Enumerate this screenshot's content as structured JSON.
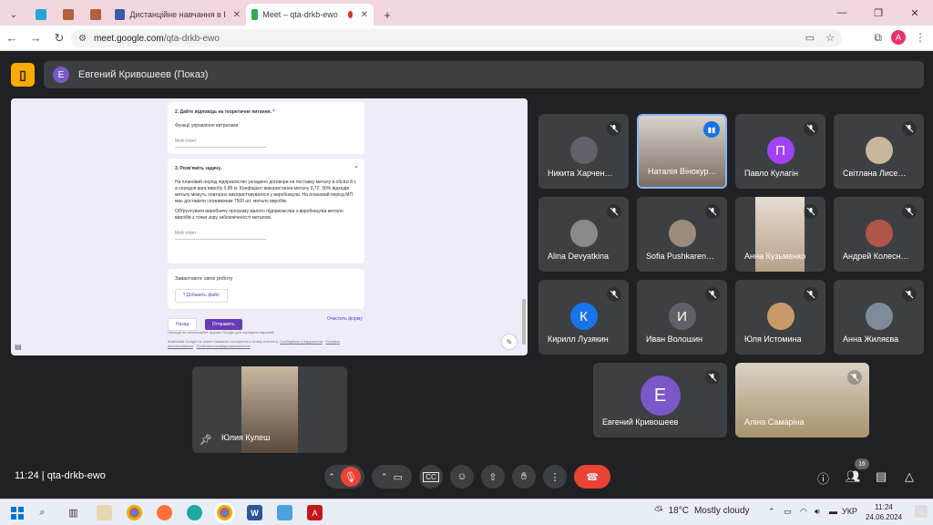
{
  "browser": {
    "tabs": [
      {
        "label": "Дистанційне навчання в ВСП"
      },
      {
        "label": "Meet – qta-drkb-ewo"
      }
    ],
    "new_tab_symbol": "+",
    "url_host": "meet.google.com",
    "url_path": "/qta-drkb-ewo",
    "profile_initial": "A"
  },
  "meet": {
    "presenter_initial": "E",
    "presenter_label": "Евгений Кривошеев (Показ)",
    "shared_form": {
      "q2_title": "2. Дайте відповідь на теоретичне питання. *",
      "q2_text": "Функції управління витратами.",
      "answer_placeholder": "Мой ответ",
      "q3_title": "3. Розв'яжіть задачу.",
      "q3_asterisk": "*",
      "q3_text": "На плановий період підприємство укладено договори на поставку металу в обсязі 8 т, а середня вага виробу 0,85 кг. Коефіцієнт використання металу 0,72. 30% відходів металу можуть повторно використовуватися у виробництві. На плановий період МП має доставити споживачам 7500 шт. метало виробів.",
      "q3_text2": "Обґрунтувати виробничу програму малого підприємства з виробництва метало виробів з точки зору забезпеченості металом.",
      "upload_title": "Завантажте свою роботу",
      "upload_button": "Добавить файл",
      "back_button": "Назад",
      "submit_button": "Отправить",
      "clear_button": "Очистить форму",
      "footer1": "Никогда не используйте формы Google для передачи паролей.",
      "footer2a": "Компания Google не имеет никакого отношения к этому контенту.",
      "footer2b": "Сообщение о нарушении",
      "footer2c": "Условия использования",
      "footer2d": "Политика конфиденциальности"
    },
    "self_tile_name": "Юлия Кулеш",
    "participants": [
      {
        "name": "Никита Харчен…",
        "initial": "",
        "color": "#5f6368"
      },
      {
        "name": "Наталія Вінокур…",
        "initial": "",
        "color": "#6d6055"
      },
      {
        "name": "Павло Кулагін",
        "initial": "П",
        "color": "#a142f4"
      },
      {
        "name": "Світлана Лисе…",
        "initial": "",
        "color": "#c9b79c"
      },
      {
        "name": "Alina Devyatkina",
        "initial": "",
        "color": "#8a8a8a"
      },
      {
        "name": "Sofia Pushkaren…",
        "initial": "",
        "color": "#9c8b7a"
      },
      {
        "name": "Анна Кузьменко",
        "initial": "",
        "color": "#b9a99a"
      },
      {
        "name": "Андрей Колесн…",
        "initial": "",
        "color": "#b0554a"
      },
      {
        "name": "Кирилл Лузякин",
        "initial": "К",
        "color": "#1a73e8"
      },
      {
        "name": "Иван Волошин",
        "initial": "И",
        "color": "#5f6368"
      },
      {
        "name": "Юля Истомина",
        "initial": "",
        "color": "#c89a6a"
      },
      {
        "name": "Анна Жиляєва",
        "initial": "",
        "color": "#7c8a9a"
      },
      {
        "name": "Евгений Кривошеев",
        "initial": "Е",
        "color": "#7b57c8"
      },
      {
        "name": "Аліна Самаріна",
        "initial": "",
        "color": "#d9d2c4"
      }
    ],
    "time": "11:24",
    "meeting_code": "qta-drkb-ewo",
    "people_count": "16"
  },
  "taskbar": {
    "temperature": "18°C",
    "weather": "Mostly cloudy",
    "language": "УКР",
    "clock_time": "11:24",
    "clock_date": "24.06.2024"
  }
}
